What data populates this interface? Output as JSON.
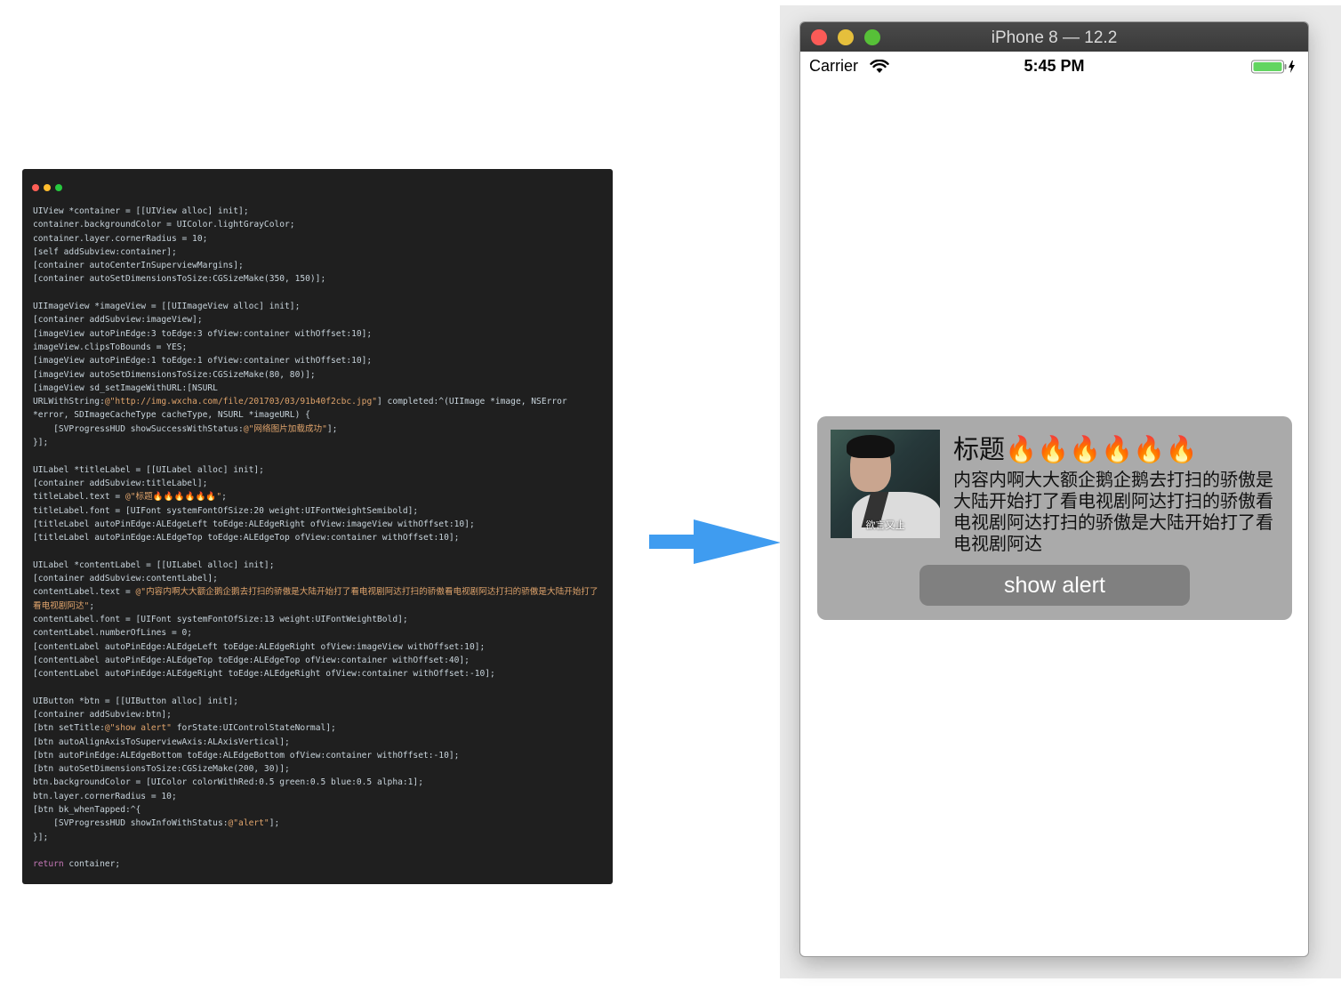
{
  "code_window": {
    "dot_colors": [
      "#ff5f56",
      "#ffbd2e",
      "#27c93f"
    ],
    "lines": [
      "UIView *container = [[UIView alloc] init];",
      "container.backgroundColor = UIColor.lightGrayColor;",
      "container.layer.cornerRadius = 10;",
      "[self addSubview:container];",
      "[container autoCenterInSuperviewMargins];",
      "[container autoSetDimensionsToSize:CGSizeMake(350, 150)];",
      "",
      "UIImageView *imageView = [[UIImageView alloc] init];",
      "[container addSubview:imageView];",
      "[imageView autoPinEdge:3 toEdge:3 ofView:container withOffset:10];",
      "imageView.clipsToBounds = YES;",
      "[imageView autoPinEdge:1 toEdge:1 ofView:container withOffset:10];",
      "[imageView autoSetDimensionsToSize:CGSizeMake(80, 80)];",
      "[imageView sd_setImageWithURL:[NSURL",
      "URLWithString:@\"http://img.wxcha.com/file/201703/03/91b40f2cbc.jpg\"] completed:^(UIImage *image, NSError",
      "*error, SDImageCacheType cacheType, NSURL *imageURL) {",
      "    [SVProgressHUD showSuccessWithStatus:@\"网络图片加载成功\"];",
      "}];",
      "",
      "UILabel *titleLabel = [[UILabel alloc] init];",
      "[container addSubview:titleLabel];",
      "titleLabel.text = @\"标题🔥🔥🔥🔥🔥🔥\";",
      "titleLabel.font = [UIFont systemFontOfSize:20 weight:UIFontWeightSemibold];",
      "[titleLabel autoPinEdge:ALEdgeLeft toEdge:ALEdgeRight ofView:imageView withOffset:10];",
      "[titleLabel autoPinEdge:ALEdgeTop toEdge:ALEdgeTop ofView:container withOffset:10];",
      "",
      "UILabel *contentLabel = [[UILabel alloc] init];",
      "[container addSubview:contentLabel];",
      "contentLabel.text = @\"内容内啊大大额企鹅企鹅去打扫的骄傲是大陆开始打了看电视剧阿达打扫的骄傲看电视剧阿达打扫的骄傲是大陆开始打了看电视剧阿达\";",
      "contentLabel.font = [UIFont systemFontOfSize:13 weight:UIFontWeightBold];",
      "contentLabel.numberOfLines = 0;",
      "[contentLabel autoPinEdge:ALEdgeLeft toEdge:ALEdgeRight ofView:imageView withOffset:10];",
      "[contentLabel autoPinEdge:ALEdgeTop toEdge:ALEdgeTop ofView:container withOffset:40];",
      "[contentLabel autoPinEdge:ALEdgeRight toEdge:ALEdgeRight ofView:container withOffset:-10];",
      "",
      "UIButton *btn = [[UIButton alloc] init];",
      "[container addSubview:btn];",
      "[btn setTitle:@\"show alert\" forState:UIControlStateNormal];",
      "[btn autoAlignAxisToSuperviewAxis:ALAxisVertical];",
      "[btn autoPinEdge:ALEdgeBottom toEdge:ALEdgeBottom ofView:container withOffset:-10];",
      "[btn autoSetDimensionsToSize:CGSizeMake(200, 30)];",
      "btn.backgroundColor = [UIColor colorWithRed:0.5 green:0.5 blue:0.5 alpha:1];",
      "btn.layer.cornerRadius = 10;",
      "[btn bk_whenTapped:^{",
      "    [SVProgressHUD showInfoWithStatus:@\"alert\"];",
      "}];",
      "",
      "return container;"
    ]
  },
  "arrow": {
    "icon": "arrow-right-icon",
    "color": "#3f9cf0"
  },
  "simulator": {
    "window_title": "iPhone 8 — 12.2",
    "traffic_colors": [
      "#fc5b57",
      "#e5bf3c",
      "#57c038"
    ],
    "status_bar": {
      "carrier": "Carrier",
      "time": "5:45 PM",
      "battery_color": "#62d560"
    },
    "container": {
      "background": "#aaaaaa",
      "image_caption": "欲言又止",
      "title": "标题🔥🔥🔥🔥🔥🔥",
      "content": "内容内啊大大额企鹅企鹅去打扫的骄傲是大陆开始打了看电视剧阿达打扫的骄傲看电视剧阿达打扫的骄傲是大陆开始打了看电视剧阿达",
      "button_label": "show alert",
      "button_color": "#808080"
    }
  }
}
